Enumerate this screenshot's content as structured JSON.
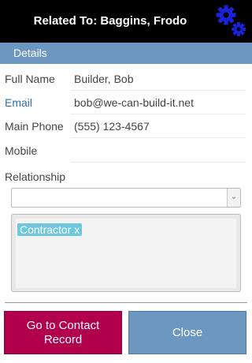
{
  "header": {
    "title": "Related To: Baggins, Frodo",
    "settings_icon": "gears-icon"
  },
  "section": {
    "title": "Details"
  },
  "fields": [
    {
      "label": "Full Name",
      "value": "Builder, Bob",
      "link": false
    },
    {
      "label": "Email",
      "value": "bob@we-can-build-it.net",
      "link": true
    },
    {
      "label": "Main Phone",
      "value": "(555) 123-4567",
      "link": false
    },
    {
      "label": "Mobile",
      "value": "",
      "link": false
    }
  ],
  "relationship": {
    "label": "Relationship",
    "selected": "",
    "tags": [
      "Contractor x"
    ]
  },
  "buttons": {
    "contact": "Go to Contact Record",
    "close": "Close"
  },
  "colors": {
    "header_bg": "#000000",
    "accent_blue": "#6b97c0",
    "gear_blue": "#1a22d8",
    "contact_button": "#b3004d",
    "tag_bg": "#6ec7dc"
  }
}
